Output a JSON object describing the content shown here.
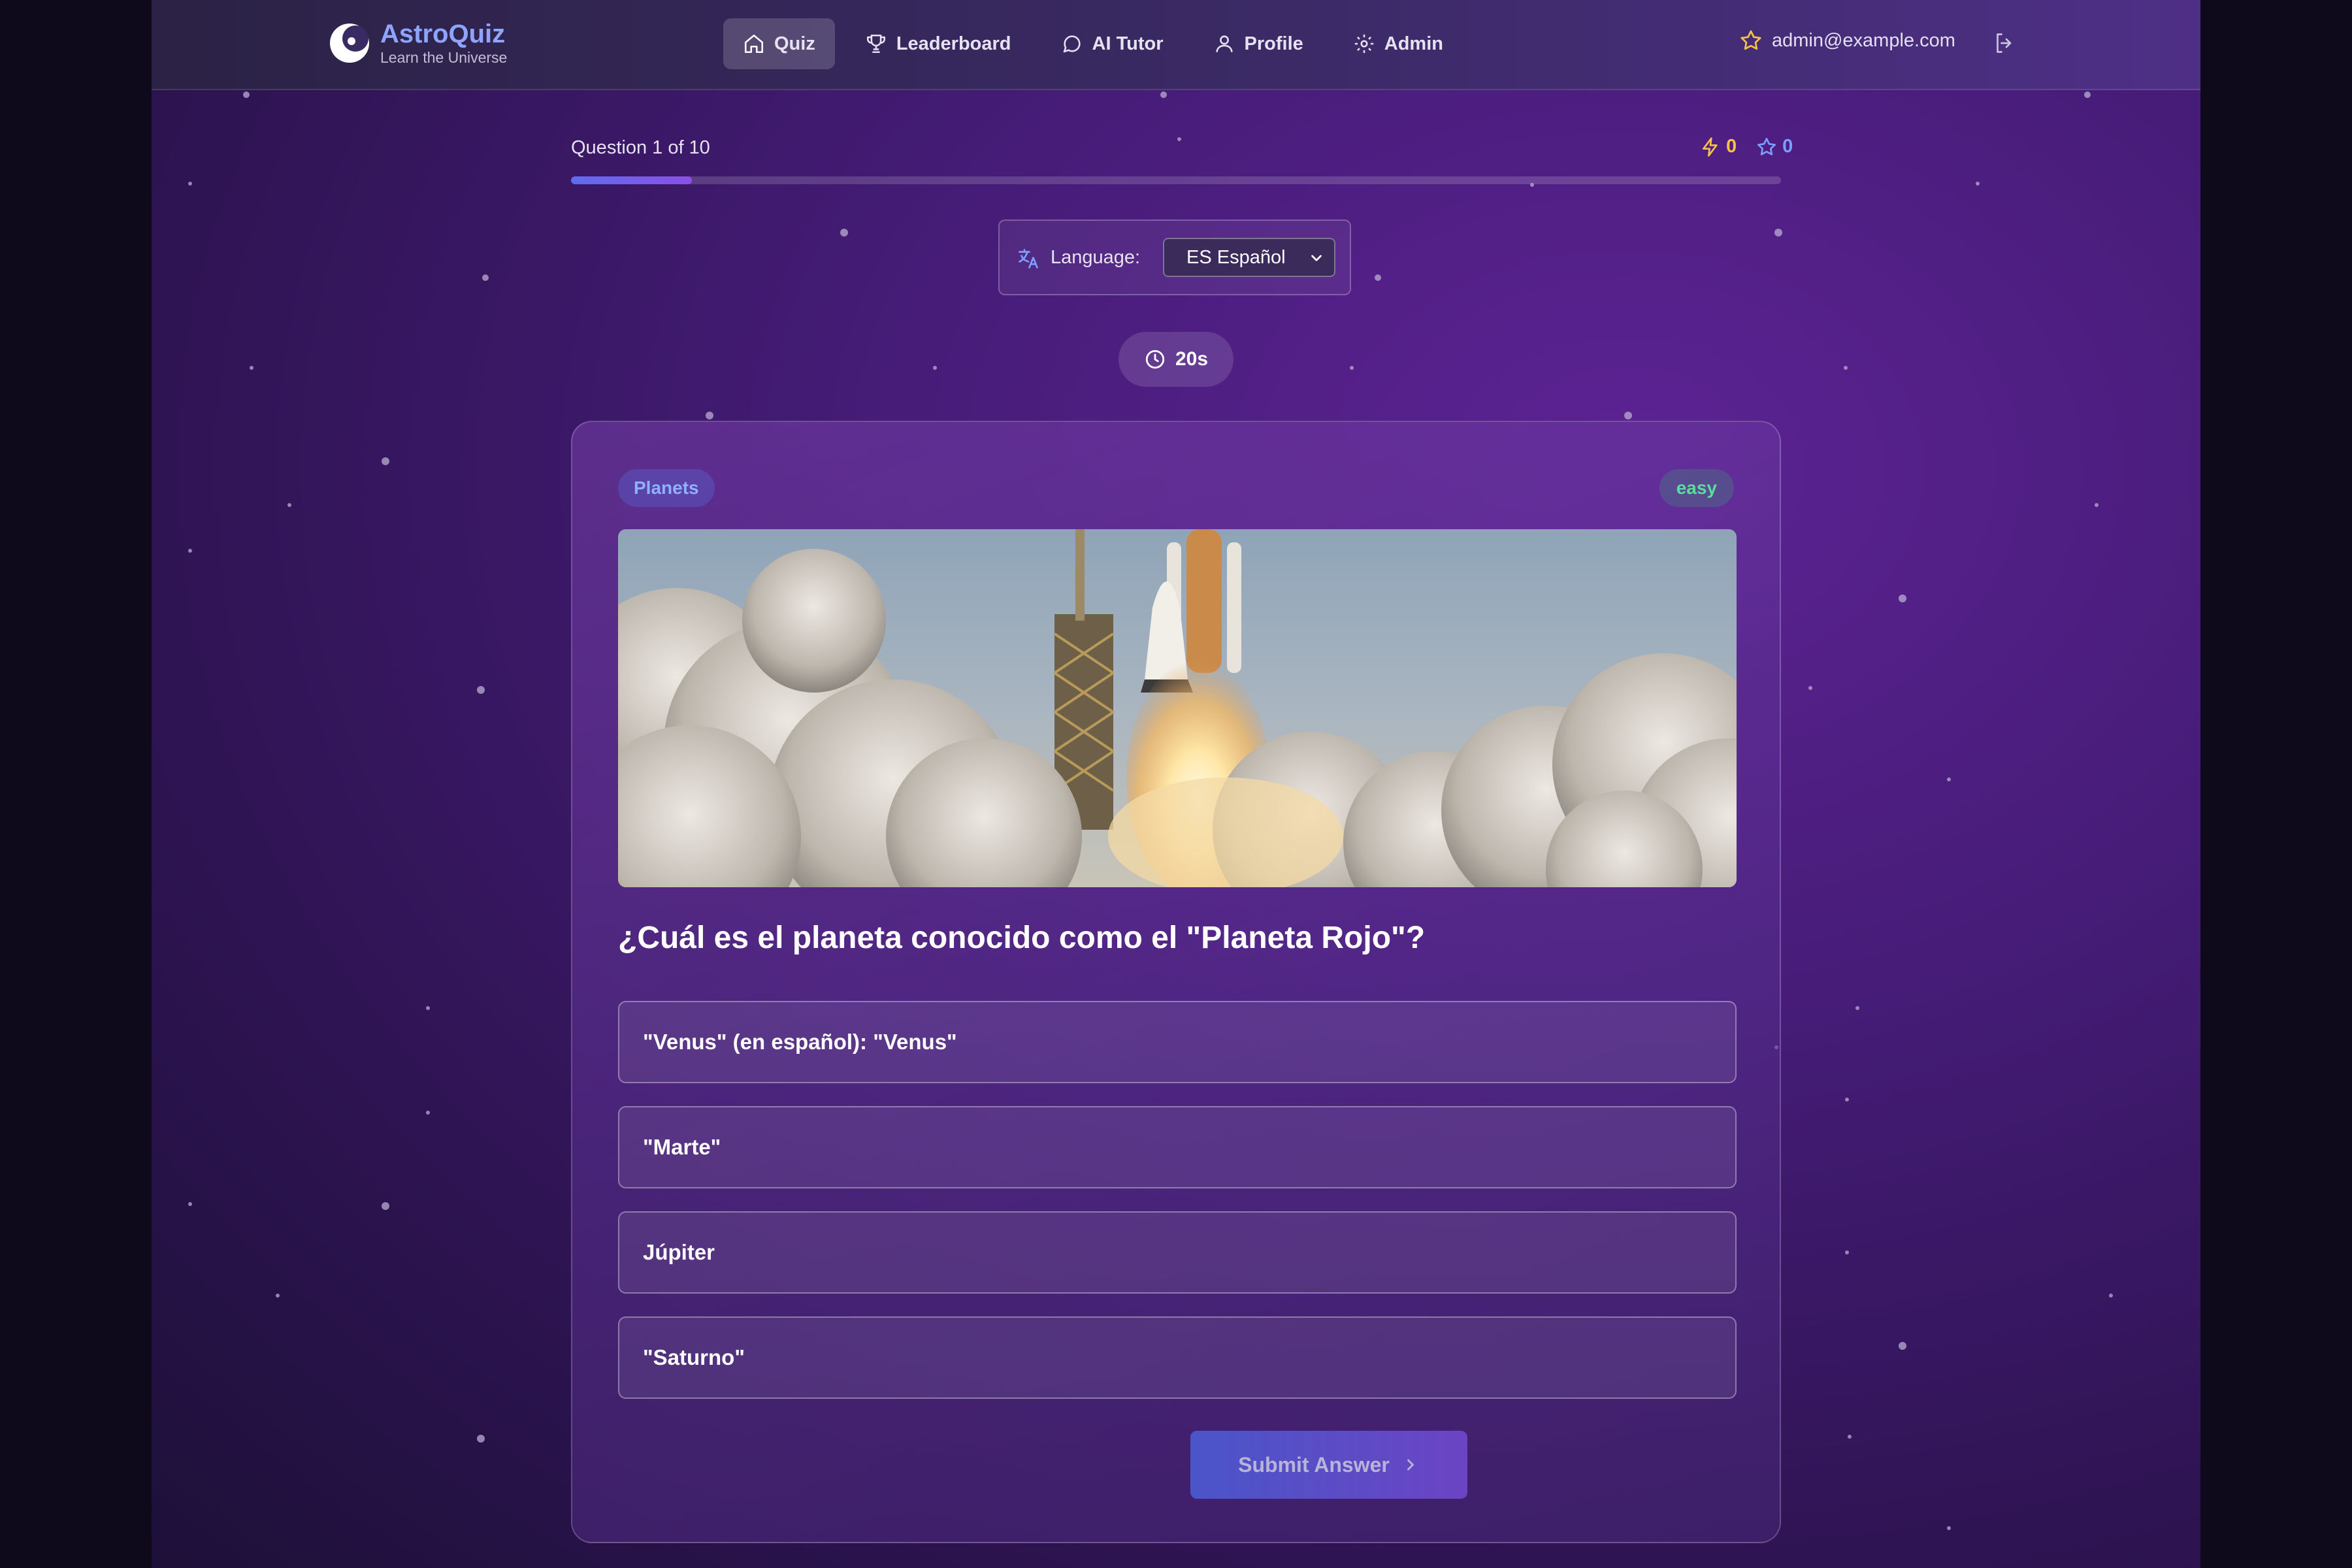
{
  "app": {
    "name": "AstroQuiz",
    "tagline": "Learn the Universe"
  },
  "nav": {
    "items": [
      {
        "label": "Quiz",
        "icon": "home-icon",
        "active": true
      },
      {
        "label": "Leaderboard",
        "icon": "trophy-icon",
        "active": false
      },
      {
        "label": "AI Tutor",
        "icon": "chat-bubble-icon",
        "active": false
      },
      {
        "label": "Profile",
        "icon": "user-icon",
        "active": false
      },
      {
        "label": "Admin",
        "icon": "gear-icon",
        "active": false
      }
    ]
  },
  "user": {
    "email": "admin@example.com",
    "icon": "star-outline-icon",
    "logout_icon": "logout-icon"
  },
  "progress": {
    "label": "Question 1 of 10",
    "current": 1,
    "total": 10,
    "fraction": 0.1
  },
  "stats": {
    "streak": "0",
    "stars": "0"
  },
  "language": {
    "label": "Language:",
    "selected": "ES Español",
    "icon": "translate-icon"
  },
  "timer": {
    "value": "20s",
    "icon": "clock-icon"
  },
  "question": {
    "category": "Planets",
    "difficulty": "easy",
    "image": "space-shuttle-launch",
    "text": "¿Cuál es el planeta conocido como el \"Planeta Rojo\"?",
    "options": [
      "\"Venus\" (en español): \"Venus\"",
      "\"Marte\"",
      "Júpiter",
      "\"Saturno\""
    ]
  },
  "submit": {
    "label": "Submit Answer",
    "icon": "chevron-right-icon"
  },
  "colors": {
    "accent": "#8ea4ff",
    "progress_fill": "#5e6cf0",
    "bolt": "#f6c244",
    "star": "#7aa0ff",
    "difficulty_easy": "#5cdb9c",
    "background": "#461c78"
  }
}
